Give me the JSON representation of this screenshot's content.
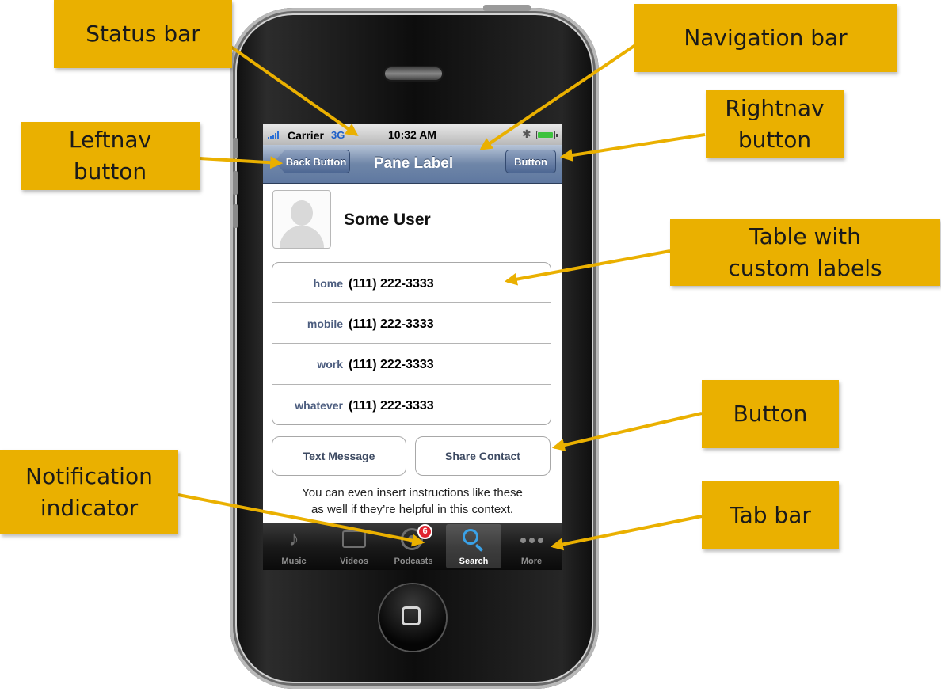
{
  "status_bar": {
    "carrier": "Carrier",
    "network": "3G",
    "time": "10:32 AM"
  },
  "nav_bar": {
    "back_button": "Back Button",
    "title": "Pane Label",
    "right_button": "Button"
  },
  "contact": {
    "name": "Some User",
    "phones": [
      {
        "label": "home",
        "number": "(111) 222-3333"
      },
      {
        "label": "mobile",
        "number": "(111) 222-3333"
      },
      {
        "label": "work",
        "number": "(111) 222-3333"
      },
      {
        "label": "whatever",
        "number": "(111) 222-3333"
      }
    ]
  },
  "actions": {
    "text_message": "Text Message",
    "share_contact": "Share Contact"
  },
  "instructions": [
    "You can even insert instructions like these",
    "as well if they’re helpful in this context."
  ],
  "tab_bar": {
    "tabs": [
      {
        "label": "Music",
        "icon": "music-note-icon"
      },
      {
        "label": "Videos",
        "icon": "video-screen-icon"
      },
      {
        "label": "Podcasts",
        "icon": "podcast-icon",
        "badge": "6"
      },
      {
        "label": "Search",
        "icon": "search-icon",
        "selected": true
      },
      {
        "label": "More",
        "icon": "more-dots-icon"
      }
    ]
  },
  "callouts": {
    "status_bar": "Status bar",
    "navigation_bar": "Navigation bar",
    "rightnav_button": [
      "Rightnav",
      "button"
    ],
    "leftnav_button": [
      "Leftnav",
      "button"
    ],
    "table_custom_labels": [
      "Table with",
      "custom labels"
    ],
    "button": "Button",
    "notification_indicator": [
      "Notification",
      "indicator"
    ],
    "tab_bar": "Tab bar"
  },
  "colors": {
    "callout_fill": "#eab000",
    "arrow": "#eab000",
    "nav_bar": "#6f86a8",
    "badge": "#e0242f",
    "signal": "#2a6fd6",
    "battery": "#3dc23d"
  }
}
